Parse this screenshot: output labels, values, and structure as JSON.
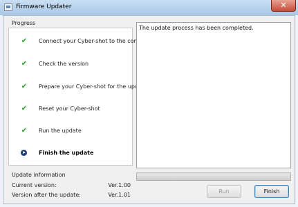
{
  "window": {
    "title": "Firmware Updater",
    "close_glyph": "✕"
  },
  "progress": {
    "title": "Progress",
    "steps": [
      {
        "label": "Connect your Cyber-shot to the computer",
        "status": "done"
      },
      {
        "label": "Check the version",
        "status": "done"
      },
      {
        "label": "Prepare your Cyber-shot for the update",
        "status": "done"
      },
      {
        "label": "Reset your Cyber-shot",
        "status": "done"
      },
      {
        "label": "Run the update",
        "status": "done"
      },
      {
        "label": "Finish the update",
        "status": "current"
      }
    ],
    "check_glyph": "✔"
  },
  "info": {
    "title": "Update information",
    "current_label": "Current version:",
    "current_value": "Ver.1.00",
    "after_label": "Version after the update:",
    "after_value": "Ver.1.01"
  },
  "message": "The update process has been completed.",
  "progressbar": {
    "fraction": 1.0
  },
  "buttons": {
    "run": "Run",
    "finish": "Finish"
  },
  "colors": {
    "check": "#2a9d2a",
    "current_step": "#1a3f78"
  }
}
